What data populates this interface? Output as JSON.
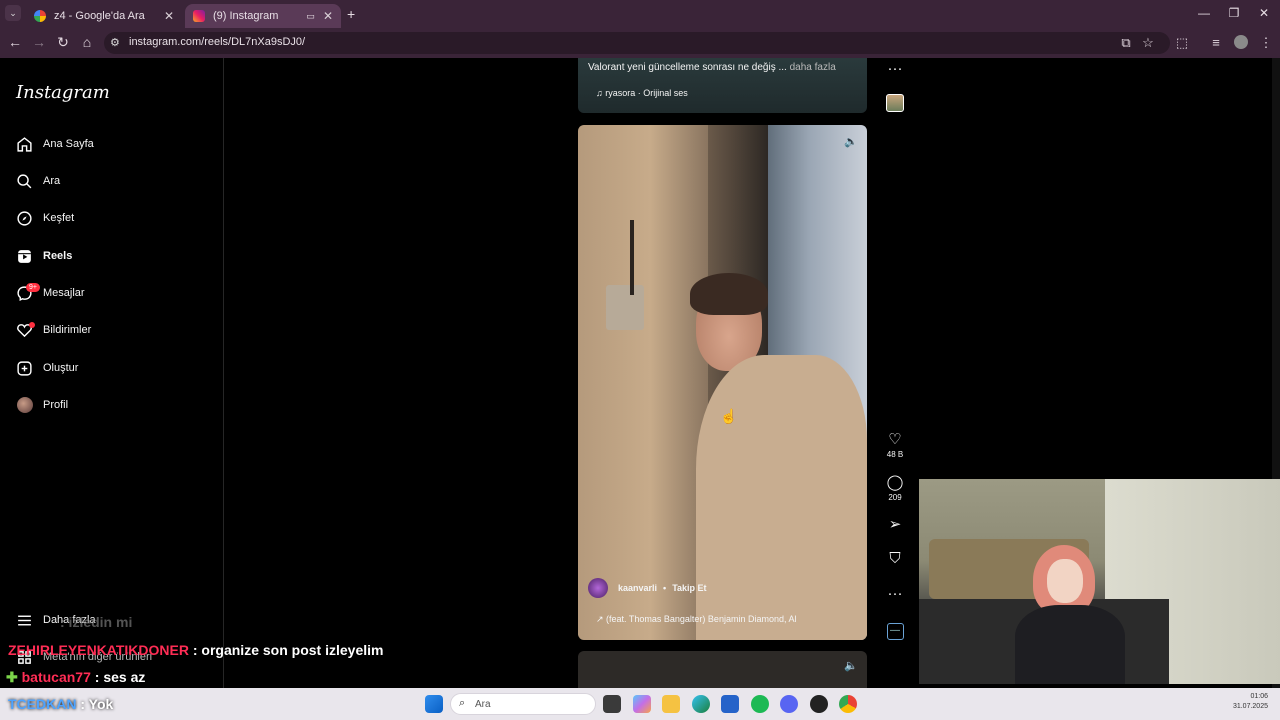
{
  "browser": {
    "tabs": [
      {
        "title": "z4 - Google'da Ara"
      },
      {
        "title": "(9) Instagram"
      }
    ],
    "url": "instagram.com/reels/DL7nXa9sDJ0/"
  },
  "instagram": {
    "logo": "Instagram",
    "nav": [
      {
        "label": "Ana Sayfa",
        "icon": "home-icon"
      },
      {
        "label": "Ara",
        "icon": "search-icon"
      },
      {
        "label": "Keşfet",
        "icon": "compass-icon"
      },
      {
        "label": "Reels",
        "icon": "reels-icon"
      },
      {
        "label": "Mesajlar",
        "icon": "messenger-icon"
      },
      {
        "label": "Bildirimler",
        "icon": "heart-icon"
      },
      {
        "label": "Oluştur",
        "icon": "plus-icon"
      },
      {
        "label": "Profil",
        "icon": "avatar-icon"
      }
    ],
    "messages_badge": "9+",
    "more_label": "Daha fazla",
    "meta_label": "Meta'nın diğer ürünleri",
    "top_reel": {
      "caption": "Valorant yeni güncelleme sonrası ne değiş ...",
      "more": "daha fazla",
      "audio": "ryasora · Orijinal ses"
    },
    "main_reel": {
      "username": "kaanvarli",
      "follow": "Takip Et",
      "audio": "(feat. Thomas Bangalter)  Benjamin Diamond, Al"
    },
    "actions": {
      "likes": "48 B",
      "comments": "209"
    }
  },
  "chat_overlay": [
    {
      "user": "",
      "message": ": izledin mi",
      "user_color": "#a0a0a0"
    },
    {
      "user": "ZEHIRLEYENKATIKDONER",
      "message": " : organize son post izleyelim",
      "user_color": "#ff2d55"
    },
    {
      "user": "batucan77",
      "message": " : ses az",
      "user_color": "#ff2d55"
    },
    {
      "user": "TCEDKAN",
      "message": " : Yok",
      "user_color": "#4da3ff"
    }
  ],
  "taskbar": {
    "search_placeholder": "Ara",
    "time": "01:06",
    "date": "31.07.2025"
  }
}
